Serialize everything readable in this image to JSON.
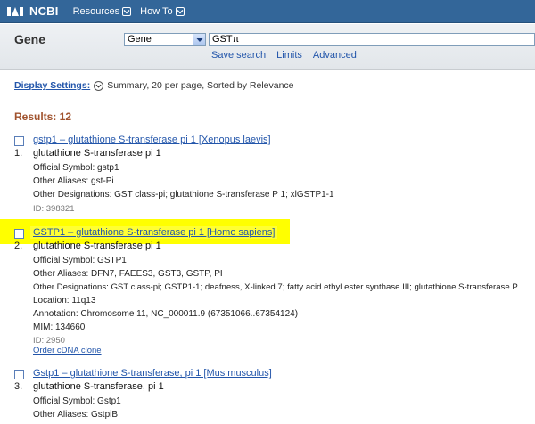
{
  "header": {
    "logo_text": "NCBI",
    "menu": [
      {
        "label": "Resources"
      },
      {
        "label": "How To"
      }
    ]
  },
  "search": {
    "db_title": "Gene",
    "db_selected": "Gene",
    "term_value": "GSTπ",
    "links": [
      "Save search",
      "Limits",
      "Advanced"
    ]
  },
  "display_settings": {
    "label": "Display Settings:",
    "summary": "Summary, 20 per page, Sorted by Relevance"
  },
  "results_label": "Results: 12",
  "results": [
    {
      "num": "1.",
      "title": "gstp1 – glutathione S-transferase pi 1 [Xenopus laevis]",
      "description": "glutathione S-transferase pi 1",
      "lines": [
        "Official Symbol: gstp1",
        "Other Aliases: gst-Pi",
        "Other Designations: GST class-pi; glutathione S-transferase P 1; xlGSTP1-1"
      ],
      "id": "ID: 398321"
    },
    {
      "num": "2.",
      "title": "GSTP1 – glutathione S-transferase pi 1 [Homo sapiens]",
      "description": "glutathione S-transferase pi 1",
      "lines": [
        "Official Symbol: GSTP1",
        "Other Aliases: DFN7, FAEES3, GST3, GSTP, PI",
        "Other Designations: GST class-pi; GSTP1-1; deafness, X-linked 7; fatty acid ethyl ester synthase III; glutathione S-transferase P",
        "Location: 11q13",
        "Annotation: Chromosome 11, NC_000011.9 (67351066..67354124)",
        "MIM: 134660"
      ],
      "id": "ID: 2950",
      "extra_link": "Order cDNA clone"
    },
    {
      "num": "3.",
      "title": "Gstp1 – glutathione S-transferase, pi 1 [Mus musculus]",
      "description": "glutathione S-transferase, pi 1",
      "lines": [
        "Official Symbol: Gstp1",
        "Other Aliases: GstpiB"
      ]
    }
  ],
  "colors": {
    "topbar": "#336699",
    "link": "#2255aa",
    "results_label": "#a0522d",
    "highlight": "#ffff00"
  }
}
